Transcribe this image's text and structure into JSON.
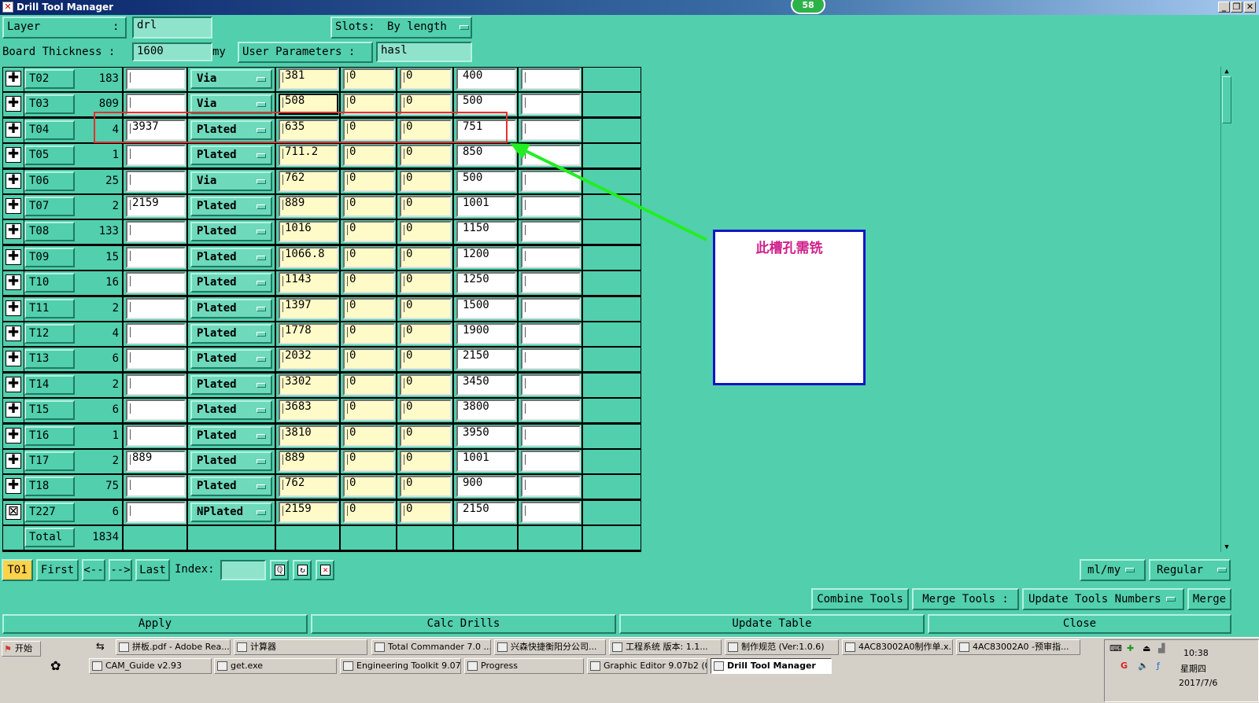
{
  "window": {
    "title": "Drill Tool Manager",
    "badge": "58",
    "min_icon": "minimize-icon",
    "max_icon": "maximize-icon",
    "close_icon": "close-icon"
  },
  "header": {
    "layer_label": "Layer",
    "layer_colon": ":",
    "layer_value": "drl",
    "slots_label": "Slots:",
    "slots_value": "By length",
    "thickness_label": "Board Thickness :",
    "thickness_value": "1600",
    "thickness_unit": "my",
    "user_params_label": "User Parameters :",
    "user_params_value": "hasl"
  },
  "rows": [
    {
      "tool": "T02",
      "count": "183",
      "c1": "",
      "type": "Via",
      "size": "381",
      "p1": "0",
      "p2": "0",
      "finish": "400",
      "c2": ""
    },
    {
      "tool": "T03",
      "count": "809",
      "c1": "",
      "type": "Via",
      "size": "508",
      "p1": "0",
      "p2": "0",
      "finish": "500",
      "c2": ""
    },
    {
      "tool": "T04",
      "count": "4",
      "c1": "3937",
      "type": "Plated",
      "size": "635",
      "p1": "0",
      "p2": "0",
      "finish": "751",
      "c2": ""
    },
    {
      "tool": "T05",
      "count": "1",
      "c1": "",
      "type": "Plated",
      "size": "711.2",
      "p1": "0",
      "p2": "0",
      "finish": "850",
      "c2": ""
    },
    {
      "tool": "T06",
      "count": "25",
      "c1": "",
      "type": "Via",
      "size": "762",
      "p1": "0",
      "p2": "0",
      "finish": "500",
      "c2": ""
    },
    {
      "tool": "T07",
      "count": "2",
      "c1": "2159",
      "type": "Plated",
      "size": "889",
      "p1": "0",
      "p2": "0",
      "finish": "1001",
      "c2": ""
    },
    {
      "tool": "T08",
      "count": "133",
      "c1": "",
      "type": "Plated",
      "size": "1016",
      "p1": "0",
      "p2": "0",
      "finish": "1150",
      "c2": ""
    },
    {
      "tool": "T09",
      "count": "15",
      "c1": "",
      "type": "Plated",
      "size": "1066.8",
      "p1": "0",
      "p2": "0",
      "finish": "1200",
      "c2": ""
    },
    {
      "tool": "T10",
      "count": "16",
      "c1": "",
      "type": "Plated",
      "size": "1143",
      "p1": "0",
      "p2": "0",
      "finish": "1250",
      "c2": ""
    },
    {
      "tool": "T11",
      "count": "2",
      "c1": "",
      "type": "Plated",
      "size": "1397",
      "p1": "0",
      "p2": "0",
      "finish": "1500",
      "c2": ""
    },
    {
      "tool": "T12",
      "count": "4",
      "c1": "",
      "type": "Plated",
      "size": "1778",
      "p1": "0",
      "p2": "0",
      "finish": "1900",
      "c2": ""
    },
    {
      "tool": "T13",
      "count": "6",
      "c1": "",
      "type": "Plated",
      "size": "2032",
      "p1": "0",
      "p2": "0",
      "finish": "2150",
      "c2": ""
    },
    {
      "tool": "T14",
      "count": "2",
      "c1": "",
      "type": "Plated",
      "size": "3302",
      "p1": "0",
      "p2": "0",
      "finish": "3450",
      "c2": ""
    },
    {
      "tool": "T15",
      "count": "6",
      "c1": "",
      "type": "Plated",
      "size": "3683",
      "p1": "0",
      "p2": "0",
      "finish": "3800",
      "c2": ""
    },
    {
      "tool": "T16",
      "count": "1",
      "c1": "",
      "type": "Plated",
      "size": "3810",
      "p1": "0",
      "p2": "0",
      "finish": "3950",
      "c2": ""
    },
    {
      "tool": "T17",
      "count": "2",
      "c1": "889",
      "type": "Plated",
      "size": "889",
      "p1": "0",
      "p2": "0",
      "finish": "1001",
      "c2": ""
    },
    {
      "tool": "T18",
      "count": "75",
      "c1": "",
      "type": "Plated",
      "size": "762",
      "p1": "0",
      "p2": "0",
      "finish": "900",
      "c2": ""
    },
    {
      "tool": "T227",
      "count": "6",
      "c1": "",
      "type": "NPlated",
      "size": "2159",
      "p1": "0",
      "p2": "0",
      "finish": "2150",
      "c2": ""
    }
  ],
  "total": {
    "label": "Total",
    "value": "1834"
  },
  "annotation": {
    "text": "此槽孔需铣",
    "highlight_color": "#e53030",
    "arrow_color": "#22ee22",
    "box_border": "#1414c8",
    "text_color": "#d0208a"
  },
  "nav": {
    "current": "T01",
    "first": "First",
    "prev": "<--",
    "next": "-->",
    "last": "Last",
    "index_label": "Index:",
    "index_value": "",
    "unit": "ml/my",
    "mode": "Regular",
    "icons": [
      "find-icon",
      "refresh-icon",
      "delete-icon"
    ]
  },
  "tools_bar": {
    "combine": "Combine Tools",
    "merge_label": "Merge Tools :",
    "update_numbers": "Update Tools Numbers",
    "merge": "Merge"
  },
  "actions": {
    "apply": "Apply",
    "calc": "Calc Drills",
    "update": "Update Table",
    "close": "Close"
  },
  "taskbar": {
    "start": "开始",
    "row1": [
      "拼板.pdf - Adobe Rea...",
      "计算器",
      "Total Commander 7.0 ...",
      "兴森快捷衡阳分公司...",
      "工程系统  版本: 1.1...",
      "制作规范 (Ver:1.0.6)",
      "4AC83002A0制作单.x...",
      "4AC83002A0 -预审指..."
    ],
    "row2": [
      "CAM_Guide v2.93",
      "get.exe",
      "Engineering Toolkit 9.07...",
      "Progress",
      "Graphic Editor 9.07b2 (0...",
      "Drill Tool Manager"
    ],
    "time": "10:38",
    "weekday": "星期四",
    "date": "2017/7/6"
  },
  "colors": {
    "background": "#52cfad",
    "input_yellow": "#fffbc8",
    "current_tool_bg": "#ffd24a"
  }
}
